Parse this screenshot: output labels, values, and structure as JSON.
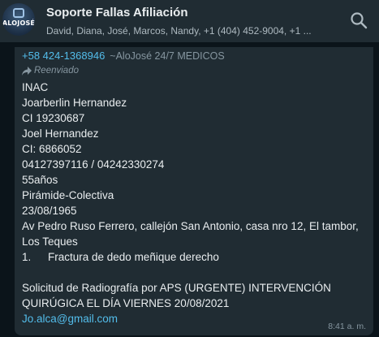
{
  "header": {
    "avatar_text": "ALOJOSÉ",
    "title": "Soporte Fallas Afiliación",
    "participants": "David, Diana, José, Marcos, Nandy, +1 (404) 452-9004, +1 ...",
    "search_icon": "search-icon"
  },
  "message": {
    "sender_phone": "+58 424-1368946",
    "sender_name": "~AloJosé 24/7 MEDICOS",
    "forwarded_label": "Reenviado",
    "lines": [
      "INAC",
      "Joarberlin Hernandez",
      "CI 19230687",
      "Joel Hernandez",
      "CI: 6866052",
      "04127397116 / 04242330274",
      "55años",
      "Pirámide-Colectiva",
      "23/08/1965",
      "Av Pedro Ruso Ferrero, callejón San Antonio, casa nro 12, El tambor,",
      "Los Teques"
    ],
    "list_item_number": "1.",
    "list_item_text": "Fractura de dedo meñique derecho",
    "request_line_1": "Solicitud de Radiografía por APS (URGENTE) INTERVENCIÓN",
    "request_line_2": "QUIRÚGICA EL DÍA VIERNES 20/08/2021",
    "email": "Jo.alca@gmail.com",
    "time": "8:41 a. m."
  },
  "colors": {
    "header_bg": "#202c33",
    "chat_bg": "#0b141a",
    "bubble_bg": "#202c33",
    "text_primary": "#e9edef",
    "text_secondary": "#8696a0",
    "link": "#53bdeb"
  }
}
